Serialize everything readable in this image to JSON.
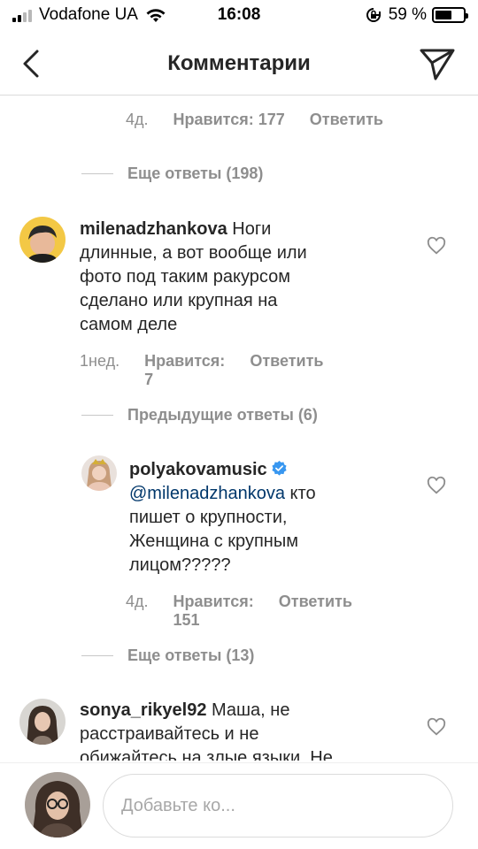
{
  "status_bar": {
    "carrier": "Vodafone UA",
    "time": "16:08",
    "battery": "59 %",
    "battery_level": 0.59
  },
  "header": {
    "title": "Комментарии"
  },
  "top_meta": {
    "time": "4д.",
    "likes": "Нравится: 177",
    "reply": "Ответить"
  },
  "more_replies_1": "Еще ответы (198)",
  "comment_1": {
    "username": "milenadzhankova",
    "text_lines": [
      "Ноги",
      "длинные, а вот вообще или",
      "фото под таким ракурсом",
      "сделано или крупная на",
      "самом деле"
    ],
    "time": "1нед.",
    "likes": "Нравится: 7",
    "reply": "Ответить"
  },
  "previous_replies": "Предыдущие ответы (6)",
  "reply_1": {
    "username": "polyakovamusic",
    "mention": "@milenadzhankova",
    "text_lines": [
      "кто",
      "пишет о крупности,",
      "Женщина с крупным",
      "лицом?????"
    ],
    "time": "4д.",
    "likes": "Нравится: 151",
    "reply": "Ответить"
  },
  "more_replies_2": "Еще ответы (13)",
  "comment_2": {
    "username": "sonya_rikyel92",
    "text_lines": [
      "Маша, не",
      "расстраивайтесь и не",
      "обижайтесь на злые языки. Не"
    ]
  },
  "composer": {
    "placeholder": "Добавьте ко..."
  },
  "colors": {
    "text": "#262626",
    "secondary": "#8e8e8e",
    "mention": "#00376b",
    "verified": "#3897f0"
  }
}
